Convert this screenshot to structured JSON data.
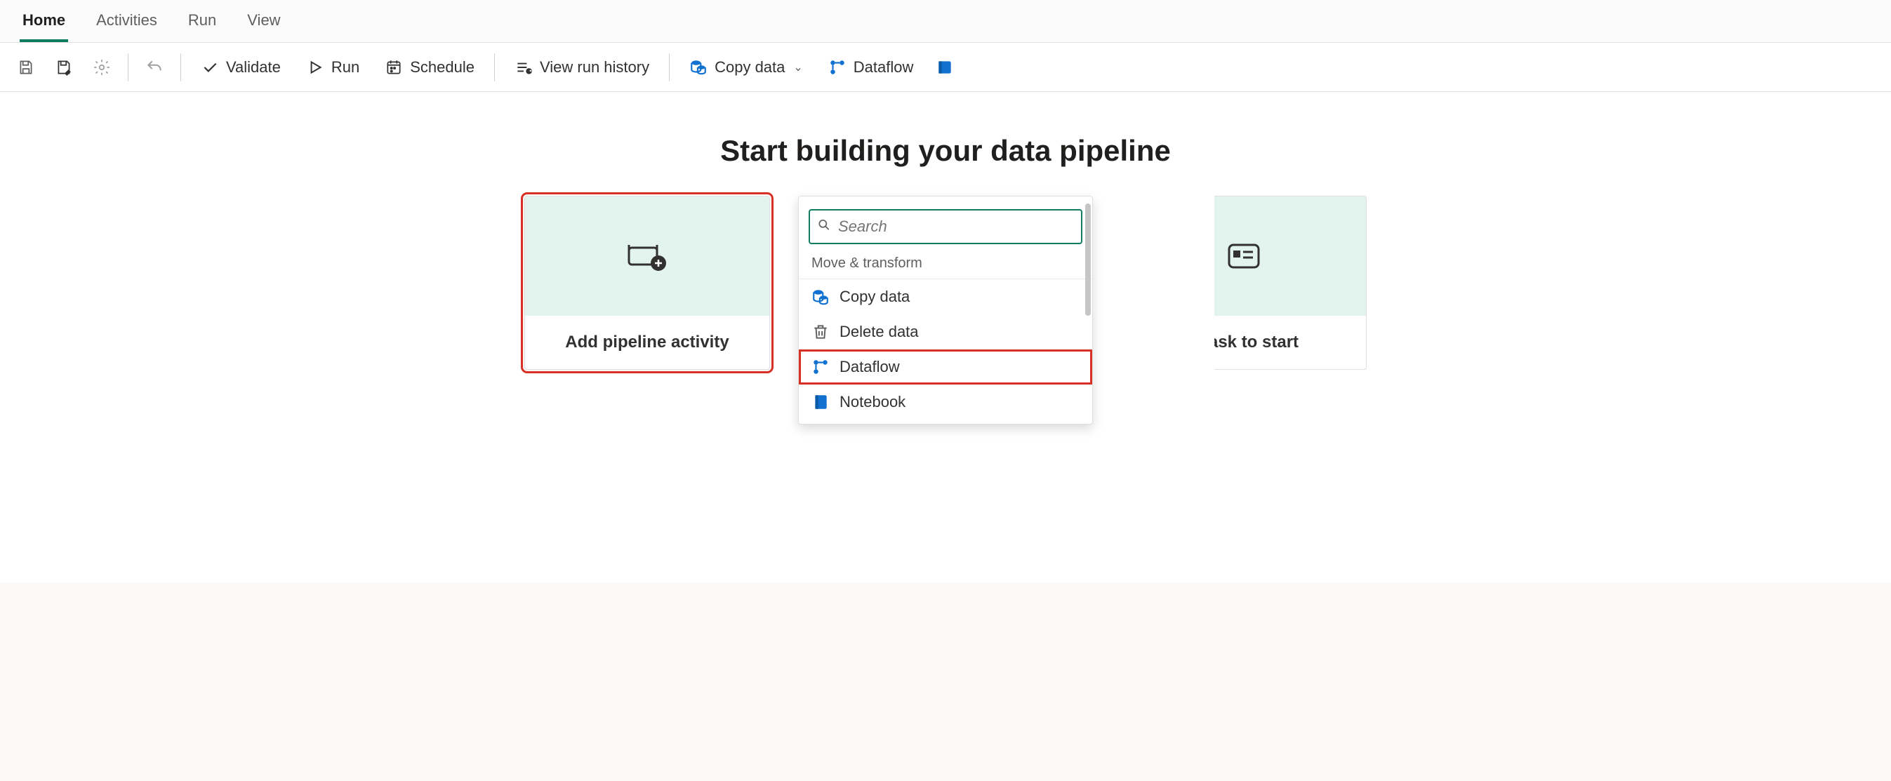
{
  "tabs": {
    "home": "Home",
    "activities": "Activities",
    "run": "Run",
    "view": "View"
  },
  "ribbon": {
    "validate": "Validate",
    "run": "Run",
    "schedule": "Schedule",
    "view_run_history": "View run history",
    "copy_data": "Copy data",
    "dataflow": "Dataflow"
  },
  "heading": "Start building your data pipeline",
  "card_add_activity": "Add pipeline activity",
  "card_choose_task": "a task to start",
  "dropdown": {
    "search_placeholder": "Search",
    "group_label": "Move & transform",
    "items": {
      "copy_data": "Copy data",
      "delete_data": "Delete data",
      "dataflow": "Dataflow",
      "notebook": "Notebook"
    }
  },
  "colors": {
    "accent": "#0f7b5f",
    "highlight": "#d93025",
    "brand_blue": "#1071d1"
  }
}
